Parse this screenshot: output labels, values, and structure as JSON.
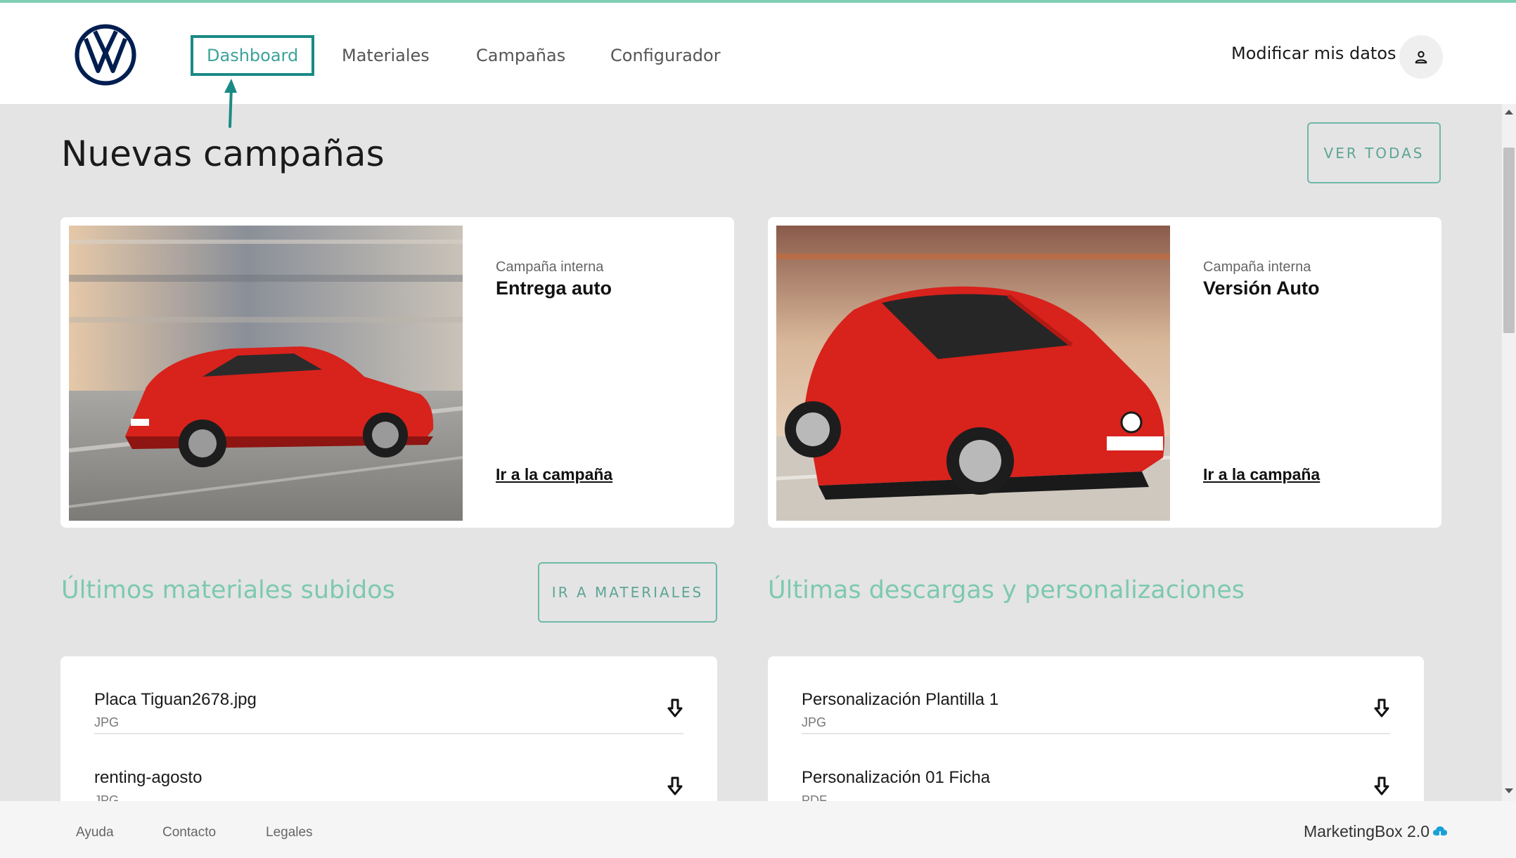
{
  "nav": {
    "items": [
      {
        "label": "Dashboard",
        "active": true
      },
      {
        "label": "Materiales"
      },
      {
        "label": "Campañas"
      },
      {
        "label": "Configurador"
      }
    ],
    "user_link": "Modificar mis datos",
    "logo_icon": "vw-logo",
    "avatar_icon": "user-icon"
  },
  "campaigns": {
    "title": "Nuevas campañas",
    "see_all": "VER TODAS",
    "cards": [
      {
        "type": "Campaña interna",
        "name": "Entrega auto",
        "link": "Ir a la campaña"
      },
      {
        "type": "Campaña interna",
        "name": "Versión Auto",
        "link": "Ir a la campaña"
      }
    ]
  },
  "materials": {
    "title": "Últimos materiales subidos",
    "button": "IR A MATERIALES",
    "items": [
      {
        "name": "Placa Tiguan2678.jpg",
        "type": "JPG"
      },
      {
        "name": "renting-agosto",
        "type": "JPG"
      }
    ]
  },
  "downloads": {
    "title": "Últimas descargas y personalizaciones",
    "items": [
      {
        "name": "Personalización Plantilla 1",
        "type": "JPG"
      },
      {
        "name": "Personalización 01 Ficha",
        "type": "PDF"
      }
    ]
  },
  "footer": {
    "links": [
      "Ayuda",
      "Contacto",
      "Legales"
    ],
    "brand": "MarketingBox 2.0"
  },
  "colors": {
    "accent": "#7dc9b0",
    "active_border": "#1a8a86",
    "vw_blue": "#001e50",
    "car_red": "#d8221c"
  }
}
